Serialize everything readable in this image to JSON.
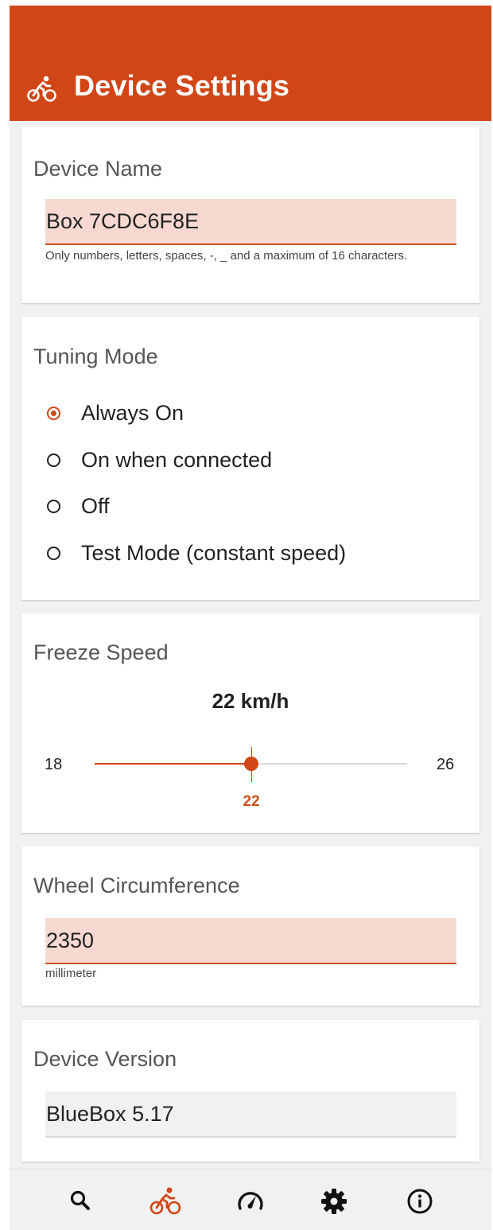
{
  "colors": {
    "primary": "#d14616",
    "field_fill": "#f7d9d2",
    "nav_active": "#d14616",
    "nav_inactive": "#111111"
  },
  "header": {
    "title": "Device Settings",
    "icon": "bike-icon"
  },
  "device_name": {
    "title": "Device Name",
    "value": "Box 7CDC6F8E",
    "helper": "Only numbers, letters, spaces, -, _ and a maximum of 16 characters."
  },
  "tuning_mode": {
    "title": "Tuning Mode",
    "selected": "Always On",
    "options": [
      "Always On",
      "On when connected",
      "Off",
      "Test Mode (constant speed)"
    ]
  },
  "freeze_speed": {
    "title": "Freeze Speed",
    "display": "22 km/h",
    "min": 18,
    "max": 26,
    "value": 22,
    "min_label": "18",
    "max_label": "26",
    "value_label": "22"
  },
  "wheel": {
    "title": "Wheel Circumference",
    "value": "2350",
    "unit": "millimeter"
  },
  "version": {
    "title": "Device Version",
    "value": "BlueBox 5.17"
  },
  "bottom_nav": {
    "active": "bike",
    "items": [
      "search-icon",
      "bike-icon",
      "speedometer-icon",
      "gear-icon",
      "info-icon"
    ]
  }
}
